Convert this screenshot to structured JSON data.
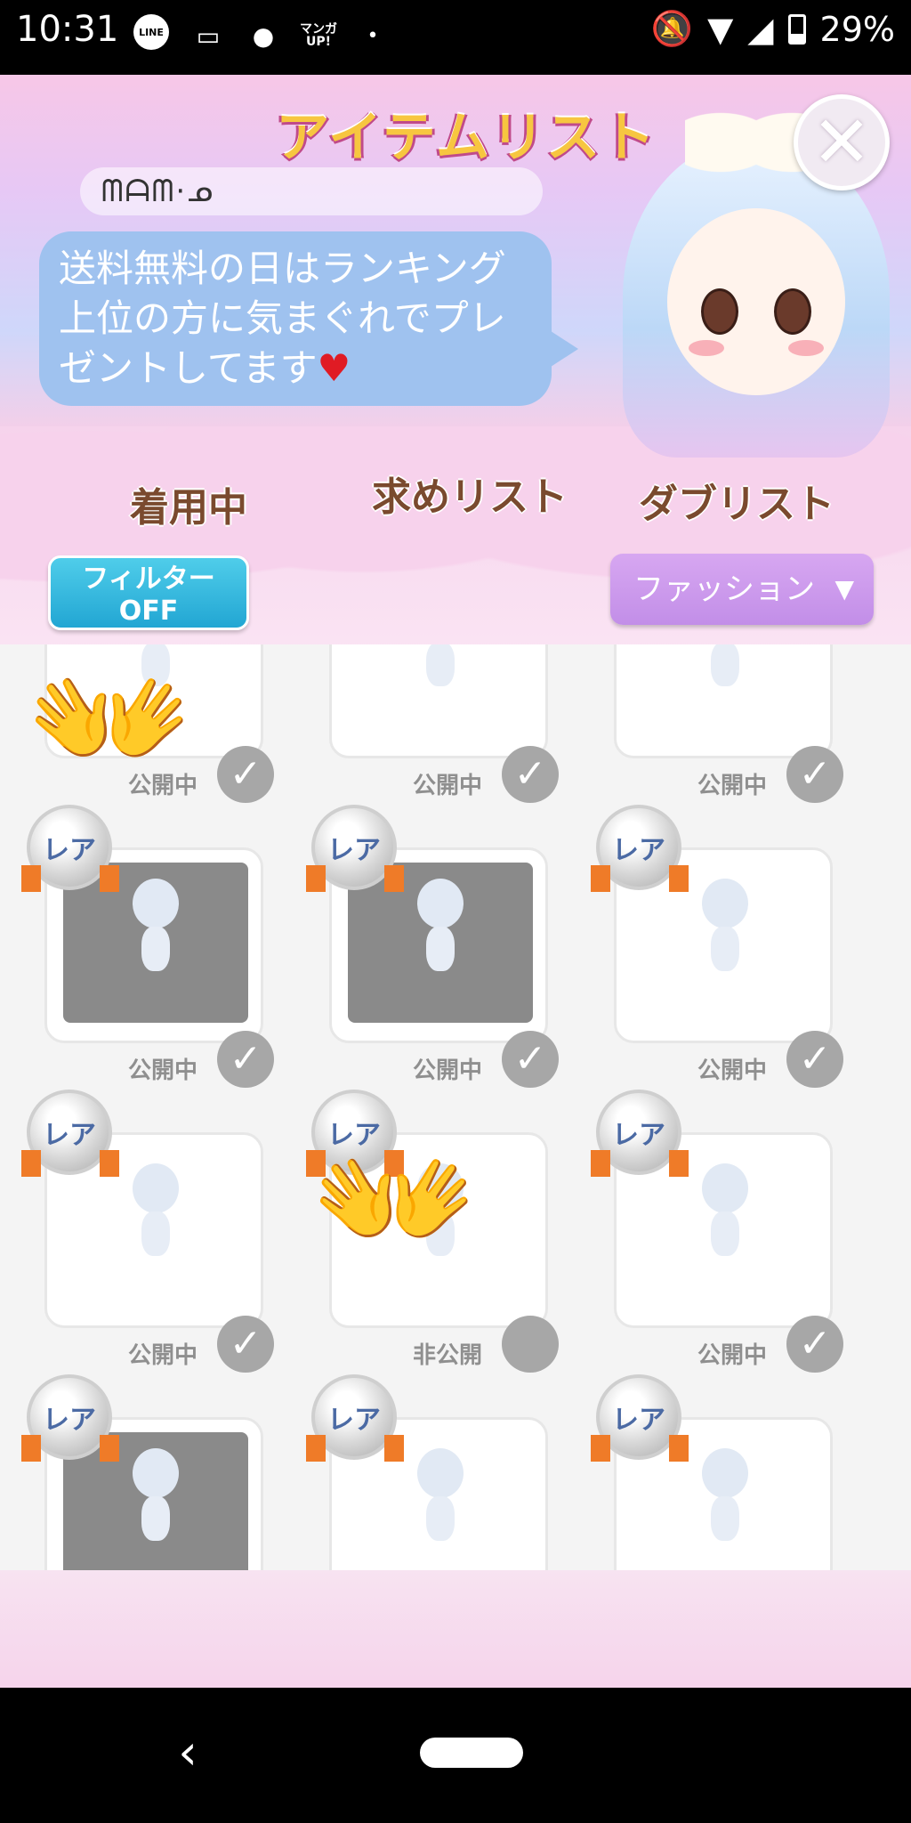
{
  "status_bar": {
    "time": "10:31",
    "battery": "29%",
    "line_badge": "LINE",
    "manga_badge": "マンガ UP!"
  },
  "header": {
    "title": "アイテムリスト",
    "username": "ᗰᗩᗰ·ᓄ",
    "bubble_text": "送料無料の日はランキング上位の方に気まぐれでプレゼントしてます",
    "bubble_heart": "♥"
  },
  "tabs": [
    {
      "label": "着用中"
    },
    {
      "label": "求めリスト"
    },
    {
      "label": "ダブリスト"
    }
  ],
  "filter": {
    "line1": "フィルター",
    "line2": "OFF"
  },
  "category": {
    "label": "ファッション",
    "arrow": "▼"
  },
  "rare_label": "レア",
  "items": [
    {
      "status": "公開中",
      "rare": false,
      "thumb": "light",
      "covered": true
    },
    {
      "status": "公開中",
      "rare": false,
      "thumb": "light",
      "covered": false
    },
    {
      "status": "公開中",
      "rare": false,
      "thumb": "light",
      "covered": false
    },
    {
      "status": "公開中",
      "rare": true,
      "thumb": "gray",
      "covered": false
    },
    {
      "status": "公開中",
      "rare": true,
      "thumb": "gray",
      "covered": false
    },
    {
      "status": "公開中",
      "rare": true,
      "thumb": "light",
      "covered": false
    },
    {
      "status": "公開中",
      "rare": true,
      "thumb": "light",
      "covered": false
    },
    {
      "status": "非公開",
      "rare": true,
      "thumb": "light",
      "covered": true
    },
    {
      "status": "公開中",
      "rare": true,
      "thumb": "light",
      "covered": false
    },
    {
      "status": "",
      "rare": true,
      "thumb": "gray",
      "covered": false
    },
    {
      "status": "",
      "rare": true,
      "thumb": "light",
      "covered": false
    },
    {
      "status": "",
      "rare": true,
      "thumb": "light",
      "covered": false
    }
  ],
  "check_glyph": "✓",
  "hands_emoji": "👐",
  "nav": {
    "back": "‹"
  },
  "colors": {
    "filter_blue": "#22a6d3",
    "category_purple": "#c28ee8",
    "title_gold": "#f7c640"
  }
}
